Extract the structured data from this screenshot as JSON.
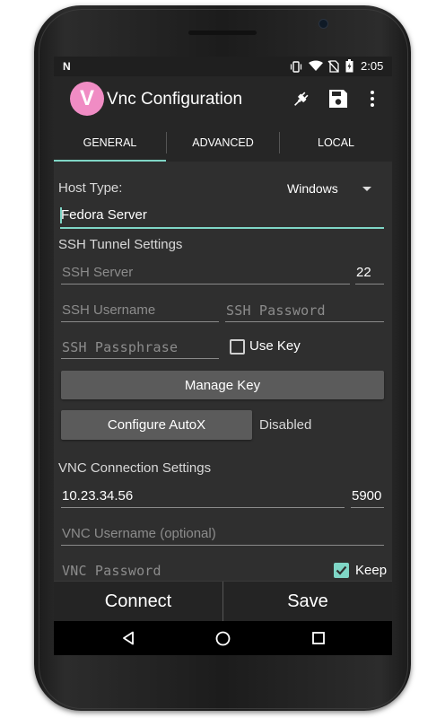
{
  "status_bar": {
    "left_icon": "n-notification-icon",
    "icons": [
      "vibrate-icon",
      "wifi-icon",
      "no-sim-icon",
      "battery-icon"
    ],
    "time": "2:05"
  },
  "app_bar": {
    "logo_letter": "V",
    "title": "Vnc Configuration",
    "actions": [
      "plug-icon",
      "save-icon",
      "overflow-menu-icon"
    ]
  },
  "tabs": [
    {
      "label": "GENERAL",
      "selected": true
    },
    {
      "label": "ADVANCED",
      "selected": false
    },
    {
      "label": "LOCAL",
      "selected": false
    }
  ],
  "form": {
    "host_type_label": "Host Type:",
    "host_type_value": "Windows",
    "nickname_value": "Fedora Server",
    "ssh_section_title": "SSH Tunnel Settings",
    "ssh_server_placeholder": "SSH Server",
    "ssh_port_value": "22",
    "ssh_username_placeholder": "SSH Username",
    "ssh_password_placeholder": "SSH Password",
    "ssh_passphrase_placeholder": "SSH Passphrase",
    "use_key_label": "Use Key",
    "use_key_checked": false,
    "manage_key_label": "Manage Key",
    "configure_autox_label": "Configure AutoX",
    "autox_status": "Disabled",
    "vnc_section_title": "VNC Connection Settings",
    "vnc_address_value": "10.23.34.56",
    "vnc_port_value": "5900",
    "vnc_username_placeholder": "VNC Username (optional)",
    "vnc_password_placeholder": "VNC Password",
    "keep_label": "Keep",
    "keep_checked": true
  },
  "bottom_bar": {
    "connect_label": "Connect",
    "save_label": "Save"
  },
  "nav_bar": [
    "back-icon",
    "home-icon",
    "recents-icon"
  ],
  "colors": {
    "accent": "#7fd6c6",
    "logo_bg": "#f08cc4",
    "logo_letter": "#ffffff",
    "background": "#2f2f2f",
    "button": "#5b5b5b"
  }
}
